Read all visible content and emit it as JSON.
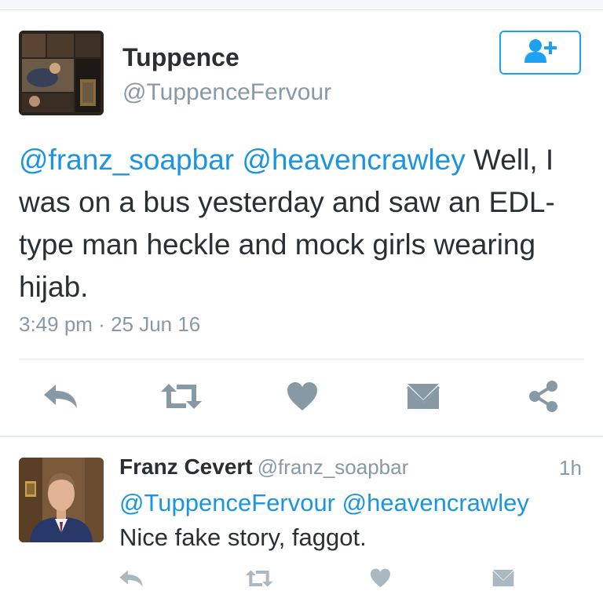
{
  "main_tweet": {
    "author_name": "Tuppence",
    "author_handle": "@TuppenceFervour",
    "mention1": "@franz_soapbar",
    "mention2": "@heavencrawley",
    "text_line1_rest": " Well, I",
    "text_body": "was on a bus yesterday and saw an EDL-type man heckle and mock girls wearing hijab.",
    "time": "3:49 pm",
    "date_sep": " · ",
    "date": "25 Jun 16"
  },
  "reply_tweet": {
    "author_name": "Franz Cevert",
    "author_handle": "@franz_soapbar",
    "time_ago": "1h",
    "mention1": "@TuppenceFervour",
    "mention2": "@heavencrawley",
    "text": "Nice fake story, faggot."
  },
  "icons": {
    "follow": "add-user-icon",
    "reply": "reply-icon",
    "retweet": "retweet-icon",
    "like": "heart-icon",
    "message": "envelope-icon",
    "share": "share-icon"
  },
  "colors": {
    "link": "#1b95e0",
    "icon": "#8899a6",
    "follow_border": "#1da1f2"
  }
}
